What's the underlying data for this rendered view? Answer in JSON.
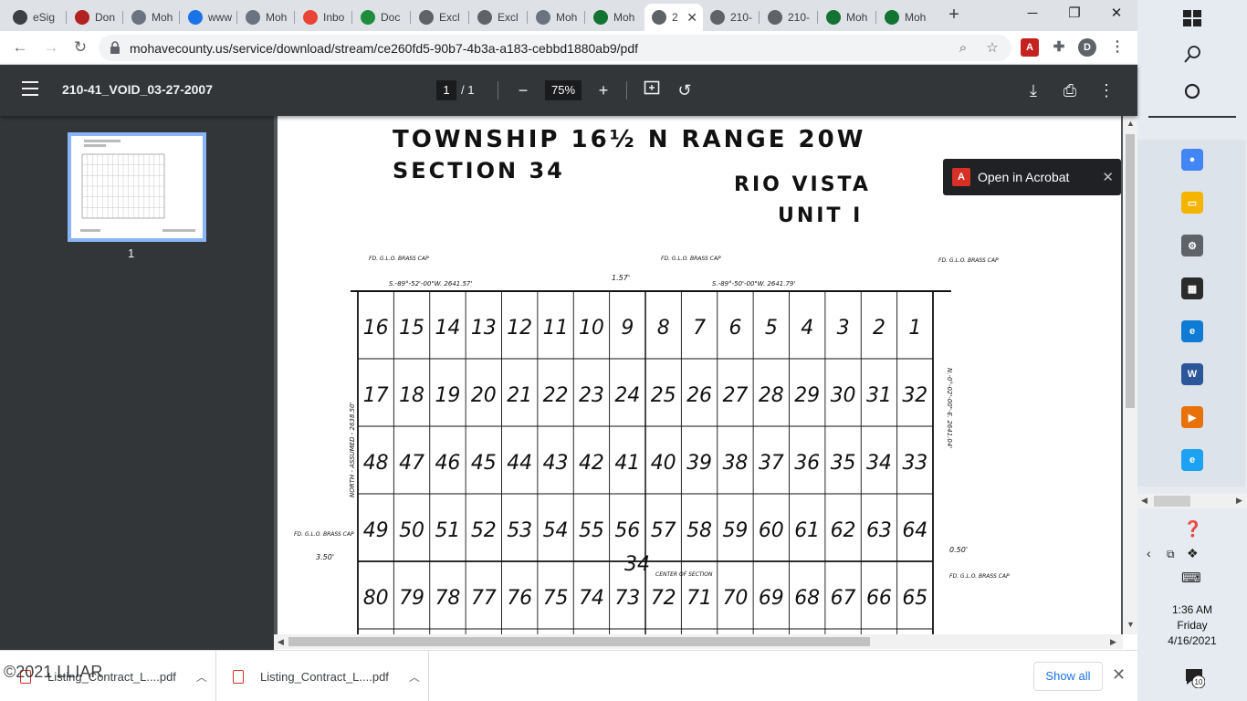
{
  "tabs": [
    {
      "label": "eSig",
      "fav": "#3c4043",
      "icon": "esig-icon"
    },
    {
      "label": "Don",
      "fav": "#b22222",
      "icon": "docusign-icon"
    },
    {
      "label": "Moh",
      "fav": "#6b7280",
      "icon": "county-seal-icon"
    },
    {
      "label": "www",
      "fav": "#1a73e8",
      "icon": "bing-icon"
    },
    {
      "label": "Moh",
      "fav": "#6b7280",
      "icon": "county-seal-icon"
    },
    {
      "label": "Inbo",
      "fav": "#ea4335",
      "icon": "gmail-icon"
    },
    {
      "label": "Doc",
      "fav": "#1e8e3e",
      "icon": "gp-icon"
    },
    {
      "label": "Excl",
      "fav": "#5f6368",
      "icon": "globe-icon"
    },
    {
      "label": "Excl",
      "fav": "#5f6368",
      "icon": "globe-icon"
    },
    {
      "label": "Moh",
      "fav": "#6b7280",
      "icon": "county-seal-icon"
    },
    {
      "label": "Moh",
      "fav": "#137333",
      "icon": "map-icon"
    },
    {
      "label": "2",
      "fav": "#5f6368",
      "icon": "globe-icon",
      "active": true
    },
    {
      "label": "210-",
      "fav": "#5f6368",
      "icon": "globe-icon"
    },
    {
      "label": "210-",
      "fav": "#5f6368",
      "icon": "globe-icon"
    },
    {
      "label": "Moh",
      "fav": "#137333",
      "icon": "map-icon"
    },
    {
      "label": "Moh",
      "fav": "#137333",
      "icon": "map-icon"
    }
  ],
  "url": "mohavecounty.us/service/download/stream/ce260fd5-90b7-4b3a-a183-cebbd1880ab9/pdf",
  "pdf": {
    "title": "210-41_VOID_03-27-2007",
    "page_current": "1",
    "page_sep": "/  1",
    "zoom": "75%",
    "thumb_label": "1"
  },
  "map": {
    "heading1": "TOWNSHIP 16½ N  RANGE 20W",
    "heading2": "SECTION  34",
    "sub1": "RIO  VISTA",
    "sub2": "UNIT  I",
    "section_num": "34",
    "center_label": "CENTER OF SECTION",
    "left_label": "NORTH - ASSUMED - 2638.50'",
    "right_label": "N.-0°-02'-00\"-E.   2641.04'",
    "top_bearing1": "S.-89°-52'-00\"W.   2641.57'",
    "top_bearing2": "S.-89°-50'-00\"W.   2641.79'",
    "corner_tl": "FD. G.L.O. BRASS CAP",
    "corner_tm": "FD. G.L.O. BRASS CAP",
    "corner_tr": "FD. G.L.O. BRASS CAP",
    "corner_w": "FD. G.L.O. BRASS CAP",
    "corner_e": "FD. G.L.O. BRASS CAP",
    "left_offset": "3.50'",
    "right_offset": "0.50'",
    "top_offset": "1.57'",
    "rows": [
      [
        "16",
        "15",
        "14",
        "13",
        "12",
        "11",
        "10",
        "9",
        "8",
        "7",
        "6",
        "5",
        "4",
        "3",
        "2",
        "1"
      ],
      [
        "17",
        "18",
        "19",
        "20",
        "21",
        "22",
        "23",
        "24",
        "25",
        "26",
        "27",
        "28",
        "29",
        "30",
        "31",
        "32"
      ],
      [
        "48",
        "47",
        "46",
        "45",
        "44",
        "43",
        "42",
        "41",
        "40",
        "39",
        "38",
        "37",
        "36",
        "35",
        "34",
        "33"
      ],
      [
        "49",
        "50",
        "51",
        "52",
        "53",
        "54",
        "55",
        "56",
        "57",
        "58",
        "59",
        "60",
        "61",
        "62",
        "63",
        "64"
      ],
      [
        "80",
        "79",
        "78",
        "77",
        "76",
        "75",
        "74",
        "73",
        "72",
        "71",
        "70",
        "69",
        "68",
        "67",
        "66",
        "65"
      ]
    ]
  },
  "acrobat": {
    "label": "Open in Acrobat"
  },
  "downloads": [
    {
      "label": "Listing_Contract_L....pdf"
    },
    {
      "label": "Listing_Contract_L....pdf"
    }
  ],
  "show_all": "Show all",
  "watermark": "©2021 LLIAR",
  "clock": {
    "time": "1:36 AM",
    "day": "Friday",
    "date": "4/16/2021"
  },
  "notification_count": "10",
  "taskbar_apps": [
    {
      "name": "chrome-icon",
      "color": "#4285f4",
      "glyph": "●"
    },
    {
      "name": "file-explorer-icon",
      "color": "#f4b400",
      "glyph": "▭"
    },
    {
      "name": "settings-icon",
      "color": "#5f6368",
      "glyph": "⚙"
    },
    {
      "name": "store-icon",
      "color": "#2b2b2b",
      "glyph": "▦"
    },
    {
      "name": "edge-icon",
      "color": "#0f7bd5",
      "glyph": "e"
    },
    {
      "name": "word-icon",
      "color": "#2b579a",
      "glyph": "W"
    },
    {
      "name": "media-icon",
      "color": "#e8710a",
      "glyph": "▶"
    },
    {
      "name": "ie-icon",
      "color": "#1da1f2",
      "glyph": "e"
    }
  ]
}
